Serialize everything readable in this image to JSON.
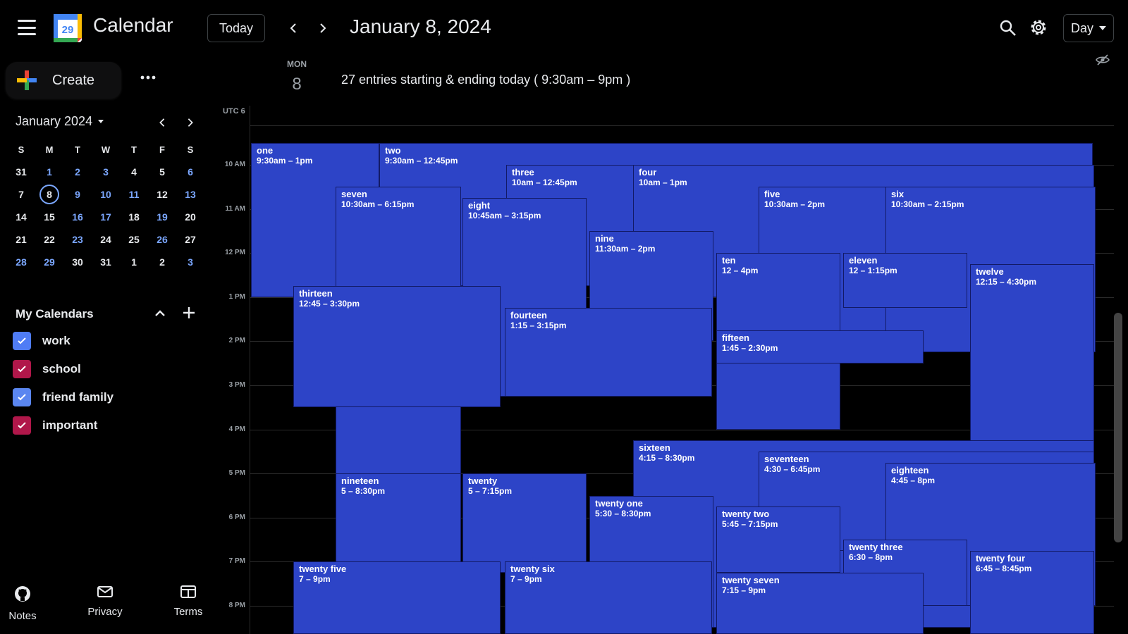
{
  "header": {
    "app_title": "Calendar",
    "logo_day": "29",
    "today_label": "Today",
    "date_title": "January 8, 2024",
    "view_label": "Day"
  },
  "sidebar": {
    "create_label": "Create",
    "mini": {
      "title": "January 2024",
      "weekdays": [
        "S",
        "M",
        "T",
        "W",
        "T",
        "F",
        "S"
      ],
      "weeks": [
        [
          "31",
          "1",
          "2",
          "3",
          "4",
          "5",
          "6"
        ],
        [
          "7",
          "8",
          "9",
          "10",
          "11",
          "12",
          "13"
        ],
        [
          "14",
          "15",
          "16",
          "17",
          "18",
          "19",
          "20"
        ],
        [
          "21",
          "22",
          "23",
          "24",
          "25",
          "26",
          "27"
        ],
        [
          "28",
          "29",
          "30",
          "31",
          "1",
          "2",
          "3"
        ]
      ],
      "selected": "8"
    },
    "my_calendars_title": "My Calendars",
    "calendars": [
      {
        "label": "work",
        "color": "#4f7cf5"
      },
      {
        "label": "school",
        "color": "#b0174a"
      },
      {
        "label": "friend family",
        "color": "#5a86f0"
      },
      {
        "label": "important",
        "color": "#b0174a"
      }
    ],
    "footer": [
      {
        "label": "Notes",
        "icon": "github-icon"
      },
      {
        "label": "Privacy",
        "icon": "mail-icon"
      },
      {
        "label": "Terms",
        "icon": "document-icon"
      }
    ]
  },
  "day_header": {
    "weekday": "MON",
    "day": "8",
    "summary": "27 entries starting & ending today ( 9:30am – 9pm )"
  },
  "timezone": "UTC 6",
  "hours": [
    "10 AM",
    "11 AM",
    "12 PM",
    "1 PM",
    "2 PM",
    "3 PM",
    "4 PM",
    "5 PM",
    "6 PM",
    "7 PM",
    "8 PM"
  ],
  "event_color": "#2d44c7",
  "events": [
    {
      "title": "one",
      "time": "9:30am – 1pm"
    },
    {
      "title": "two",
      "time": "9:30am – 12:45pm"
    },
    {
      "title": "three",
      "time": "10am – 12:45pm"
    },
    {
      "title": "four",
      "time": "10am – 1pm"
    },
    {
      "title": "five",
      "time": "10:30am – 2pm"
    },
    {
      "title": "six",
      "time": "10:30am – 2:15pm"
    },
    {
      "title": "seven",
      "time": "10:30am – 6:15pm"
    },
    {
      "title": "eight",
      "time": "10:45am – 3:15pm"
    },
    {
      "title": "nine",
      "time": "11:30am – 2pm"
    },
    {
      "title": "ten",
      "time": "12 – 4pm"
    },
    {
      "title": "eleven",
      "time": "12 – 1:15pm"
    },
    {
      "title": "twelve",
      "time": "12:15 – 4:30pm"
    },
    {
      "title": "thirteen",
      "time": "12:45 – 3:30pm"
    },
    {
      "title": "fourteen",
      "time": "1:15 – 3:15pm"
    },
    {
      "title": "fifteen",
      "time": "1:45 – 2:30pm"
    },
    {
      "title": "sixteen",
      "time": "4:15 – 8:30pm"
    },
    {
      "title": "seventeen",
      "time": "4:30 – 6:45pm"
    },
    {
      "title": "eighteen",
      "time": "4:45 – 8pm"
    },
    {
      "title": "nineteen",
      "time": "5 – 8:30pm"
    },
    {
      "title": "twenty",
      "time": "5 – 7:15pm"
    },
    {
      "title": "twenty one",
      "time": "5:30 – 8:30pm"
    },
    {
      "title": "twenty two",
      "time": "5:45 – 7:15pm"
    },
    {
      "title": "twenty three",
      "time": "6:30 – 8pm"
    },
    {
      "title": "twenty four",
      "time": "6:45 – 8:45pm"
    },
    {
      "title": "twenty five",
      "time": "7 – 9pm"
    },
    {
      "title": "twenty six",
      "time": "7 – 9pm"
    },
    {
      "title": "twenty seven",
      "time": "7:15 – 9pm"
    }
  ]
}
